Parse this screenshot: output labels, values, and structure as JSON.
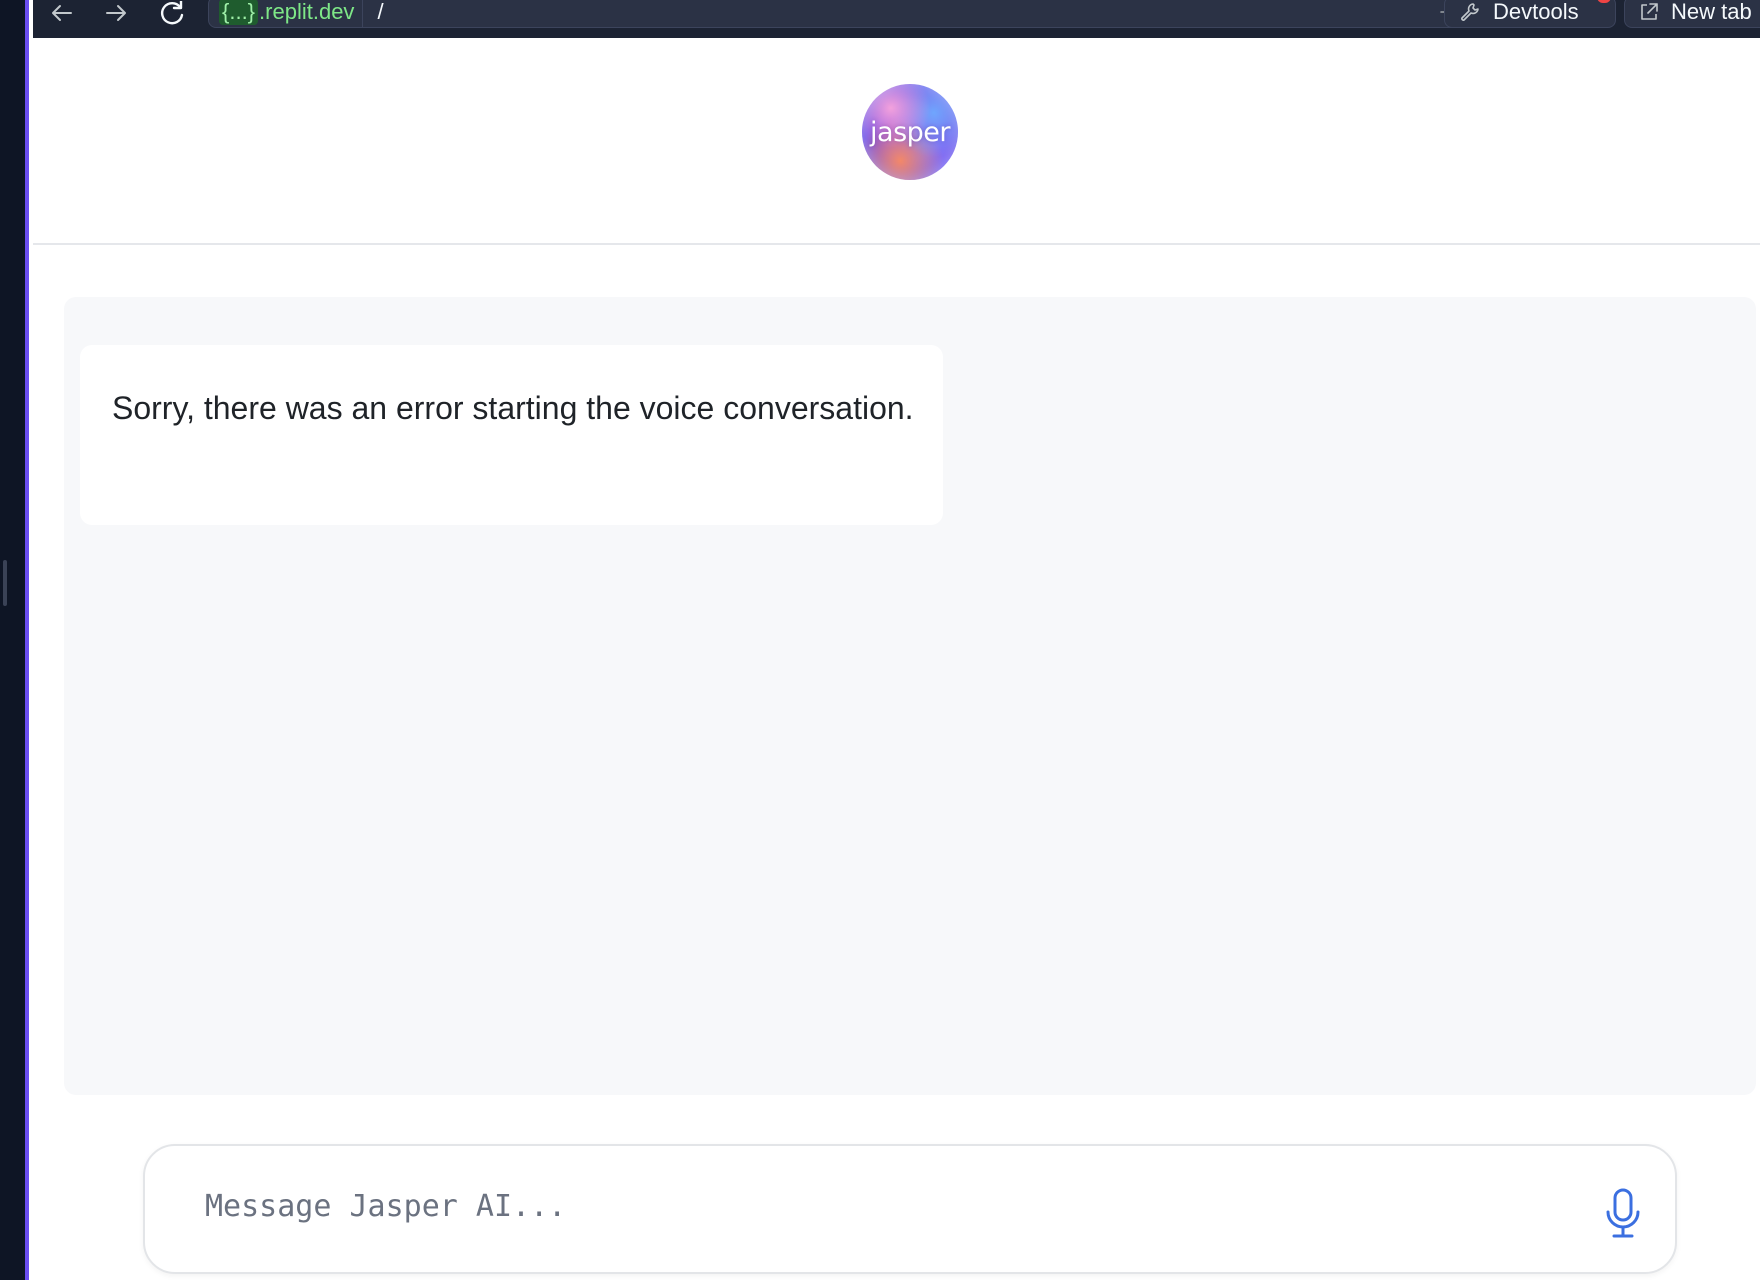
{
  "browser": {
    "url_host_chip": "{...}",
    "url_host": ".replit.dev",
    "url_path": "/",
    "devtools_label": "Devtools",
    "new_tab_label": "New tab"
  },
  "header": {
    "logo_text": "jasper"
  },
  "chat": {
    "messages": [
      {
        "text": "Sorry, there was an error starting the voice conversation."
      }
    ]
  },
  "composer": {
    "placeholder": "Message Jasper AI...",
    "value": ""
  },
  "colors": {
    "mic_icon": "#3b6fe0",
    "url_host": "#7ee787",
    "rail_accent": "#6b4ef0"
  },
  "icons": [
    "arrow-left-icon",
    "arrow-right-icon",
    "reload-icon",
    "arrow-right-small-icon",
    "wrench-icon",
    "external-link-icon",
    "microphone-icon"
  ]
}
